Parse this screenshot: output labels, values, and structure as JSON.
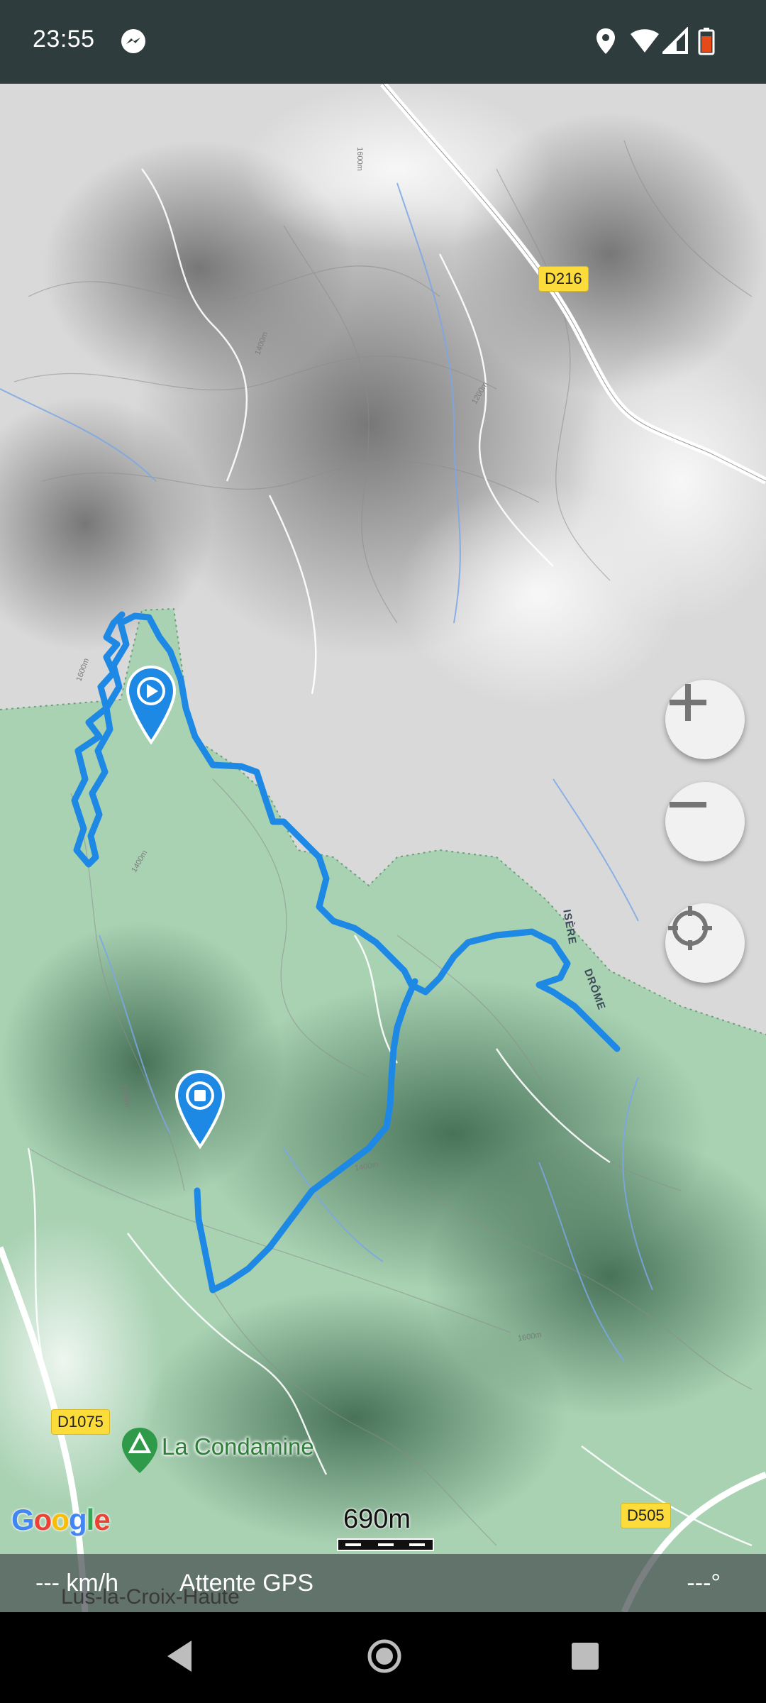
{
  "status_bar": {
    "time": "23:55",
    "icons": [
      "messenger-icon",
      "location-icon",
      "wifi-icon",
      "signal-icon",
      "battery-icon"
    ]
  },
  "map": {
    "road_labels": [
      "D216",
      "D1075",
      "D505"
    ],
    "river_labels": [
      "ISÈRE",
      "DRÔME"
    ],
    "contour_labels": [
      "1600m",
      "1400m",
      "1200m",
      "1600m",
      "1400m",
      "1200m",
      "1400m",
      "1600m"
    ],
    "place": {
      "name": "La Condamine",
      "icon": "campground-icon"
    },
    "town": "Lus-la-Croix-Haute",
    "attribution": "Google",
    "scale": "690m",
    "track_color": "#1e88e5",
    "markers": {
      "start": "play-marker-icon",
      "end": "stop-marker-icon"
    }
  },
  "controls": {
    "zoom_in": "plus-icon",
    "zoom_out": "minus-icon",
    "locate": "crosshair-icon"
  },
  "info_bar": {
    "speed": "--- km/h",
    "gps_status": "Attente GPS",
    "heading": "---°"
  },
  "nav_bar": [
    "back-icon",
    "home-icon",
    "recents-icon"
  ]
}
